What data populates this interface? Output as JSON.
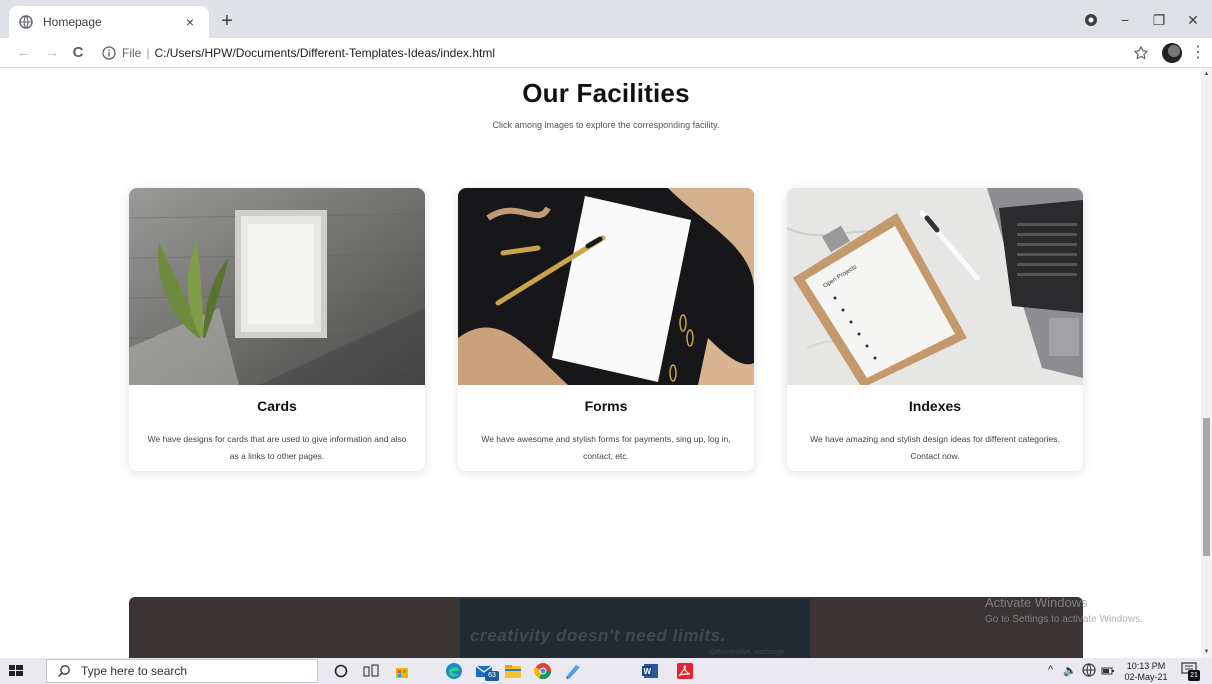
{
  "browser": {
    "tab_title": "Homepage",
    "tab_close": "×",
    "new_tab": "+",
    "address_scheme": "File",
    "address_separator": "|",
    "address_url": "C:/Users/HPW/Documents/Different-Templates-Ideas/index.html",
    "back": "←",
    "forward": "→",
    "reload": "C",
    "menu": "⋮",
    "minimize": "−",
    "maximize": "❐",
    "close": "✕"
  },
  "page": {
    "title": "Our Facilities",
    "subtitle": "Click among images to explore the corresponding facility.",
    "cards": [
      {
        "title": "Cards",
        "description": "We have designs for cards that are used to give information and also as a links to other pages."
      },
      {
        "title": "Forms",
        "description": "We have awesome and stylish forms for payments, sing up, log in, contact, etc."
      },
      {
        "title": "Indexes",
        "description": "We have amazing and stylish design ideas for different categories. Contact now."
      }
    ],
    "banner_text": "creativity doesn't need limits.",
    "banner_handle": "@thecreative_exchange",
    "clipboard_label": "Open Projects"
  },
  "windows_watermark": {
    "line1": "Activate Windows",
    "line2": "Go to Settings to activate Windows."
  },
  "taskbar": {
    "search_placeholder": "Type here to search",
    "mail_badge": "63",
    "time": "10:13 PM",
    "date": "02-May-21",
    "notification_count": "21",
    "tray_chevron": "^",
    "volume": "🔈"
  },
  "colors": {
    "accent": "#1a73e8",
    "chrome_tab_strip": "#dee1e6",
    "taskbar": "#e9e9ef",
    "banner": "#3a3534"
  }
}
